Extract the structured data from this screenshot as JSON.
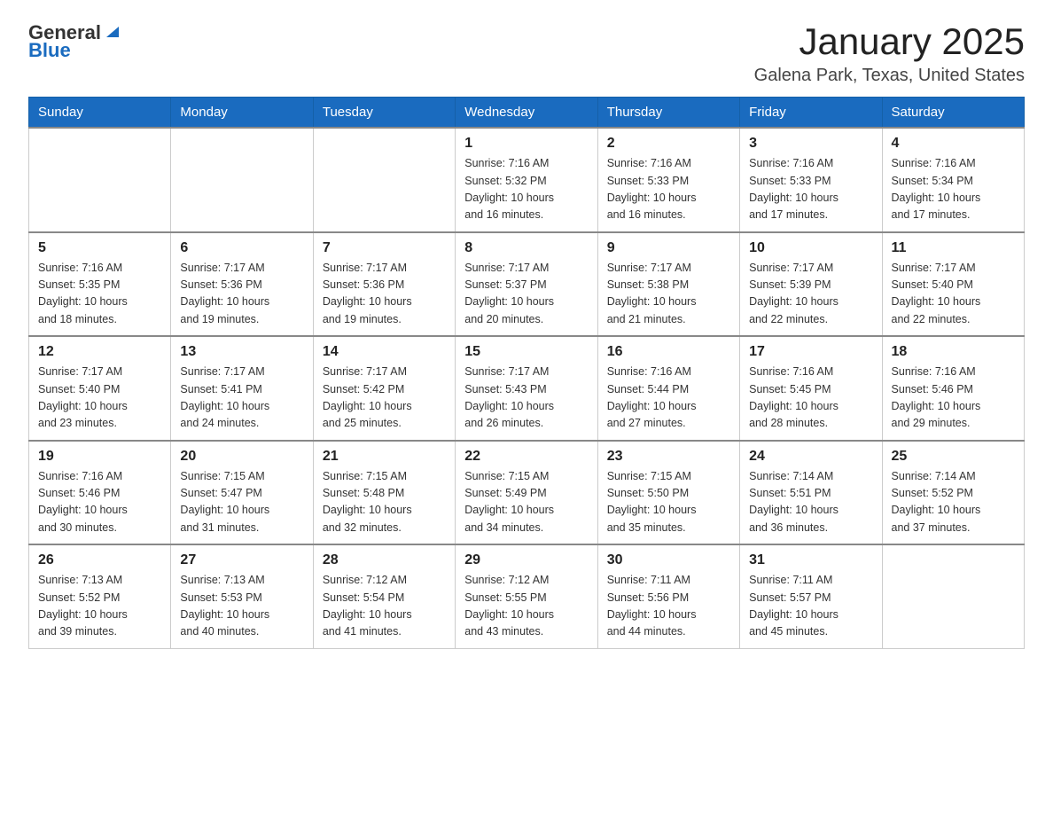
{
  "header": {
    "logo": {
      "general": "General",
      "blue": "Blue"
    },
    "month_title": "January 2025",
    "location": "Galena Park, Texas, United States"
  },
  "weekdays": [
    "Sunday",
    "Monday",
    "Tuesday",
    "Wednesday",
    "Thursday",
    "Friday",
    "Saturday"
  ],
  "weeks": [
    [
      {
        "day": "",
        "info": ""
      },
      {
        "day": "",
        "info": ""
      },
      {
        "day": "",
        "info": ""
      },
      {
        "day": "1",
        "info": "Sunrise: 7:16 AM\nSunset: 5:32 PM\nDaylight: 10 hours\nand 16 minutes."
      },
      {
        "day": "2",
        "info": "Sunrise: 7:16 AM\nSunset: 5:33 PM\nDaylight: 10 hours\nand 16 minutes."
      },
      {
        "day": "3",
        "info": "Sunrise: 7:16 AM\nSunset: 5:33 PM\nDaylight: 10 hours\nand 17 minutes."
      },
      {
        "day": "4",
        "info": "Sunrise: 7:16 AM\nSunset: 5:34 PM\nDaylight: 10 hours\nand 17 minutes."
      }
    ],
    [
      {
        "day": "5",
        "info": "Sunrise: 7:16 AM\nSunset: 5:35 PM\nDaylight: 10 hours\nand 18 minutes."
      },
      {
        "day": "6",
        "info": "Sunrise: 7:17 AM\nSunset: 5:36 PM\nDaylight: 10 hours\nand 19 minutes."
      },
      {
        "day": "7",
        "info": "Sunrise: 7:17 AM\nSunset: 5:36 PM\nDaylight: 10 hours\nand 19 minutes."
      },
      {
        "day": "8",
        "info": "Sunrise: 7:17 AM\nSunset: 5:37 PM\nDaylight: 10 hours\nand 20 minutes."
      },
      {
        "day": "9",
        "info": "Sunrise: 7:17 AM\nSunset: 5:38 PM\nDaylight: 10 hours\nand 21 minutes."
      },
      {
        "day": "10",
        "info": "Sunrise: 7:17 AM\nSunset: 5:39 PM\nDaylight: 10 hours\nand 22 minutes."
      },
      {
        "day": "11",
        "info": "Sunrise: 7:17 AM\nSunset: 5:40 PM\nDaylight: 10 hours\nand 22 minutes."
      }
    ],
    [
      {
        "day": "12",
        "info": "Sunrise: 7:17 AM\nSunset: 5:40 PM\nDaylight: 10 hours\nand 23 minutes."
      },
      {
        "day": "13",
        "info": "Sunrise: 7:17 AM\nSunset: 5:41 PM\nDaylight: 10 hours\nand 24 minutes."
      },
      {
        "day": "14",
        "info": "Sunrise: 7:17 AM\nSunset: 5:42 PM\nDaylight: 10 hours\nand 25 minutes."
      },
      {
        "day": "15",
        "info": "Sunrise: 7:17 AM\nSunset: 5:43 PM\nDaylight: 10 hours\nand 26 minutes."
      },
      {
        "day": "16",
        "info": "Sunrise: 7:16 AM\nSunset: 5:44 PM\nDaylight: 10 hours\nand 27 minutes."
      },
      {
        "day": "17",
        "info": "Sunrise: 7:16 AM\nSunset: 5:45 PM\nDaylight: 10 hours\nand 28 minutes."
      },
      {
        "day": "18",
        "info": "Sunrise: 7:16 AM\nSunset: 5:46 PM\nDaylight: 10 hours\nand 29 minutes."
      }
    ],
    [
      {
        "day": "19",
        "info": "Sunrise: 7:16 AM\nSunset: 5:46 PM\nDaylight: 10 hours\nand 30 minutes."
      },
      {
        "day": "20",
        "info": "Sunrise: 7:15 AM\nSunset: 5:47 PM\nDaylight: 10 hours\nand 31 minutes."
      },
      {
        "day": "21",
        "info": "Sunrise: 7:15 AM\nSunset: 5:48 PM\nDaylight: 10 hours\nand 32 minutes."
      },
      {
        "day": "22",
        "info": "Sunrise: 7:15 AM\nSunset: 5:49 PM\nDaylight: 10 hours\nand 34 minutes."
      },
      {
        "day": "23",
        "info": "Sunrise: 7:15 AM\nSunset: 5:50 PM\nDaylight: 10 hours\nand 35 minutes."
      },
      {
        "day": "24",
        "info": "Sunrise: 7:14 AM\nSunset: 5:51 PM\nDaylight: 10 hours\nand 36 minutes."
      },
      {
        "day": "25",
        "info": "Sunrise: 7:14 AM\nSunset: 5:52 PM\nDaylight: 10 hours\nand 37 minutes."
      }
    ],
    [
      {
        "day": "26",
        "info": "Sunrise: 7:13 AM\nSunset: 5:52 PM\nDaylight: 10 hours\nand 39 minutes."
      },
      {
        "day": "27",
        "info": "Sunrise: 7:13 AM\nSunset: 5:53 PM\nDaylight: 10 hours\nand 40 minutes."
      },
      {
        "day": "28",
        "info": "Sunrise: 7:12 AM\nSunset: 5:54 PM\nDaylight: 10 hours\nand 41 minutes."
      },
      {
        "day": "29",
        "info": "Sunrise: 7:12 AM\nSunset: 5:55 PM\nDaylight: 10 hours\nand 43 minutes."
      },
      {
        "day": "30",
        "info": "Sunrise: 7:11 AM\nSunset: 5:56 PM\nDaylight: 10 hours\nand 44 minutes."
      },
      {
        "day": "31",
        "info": "Sunrise: 7:11 AM\nSunset: 5:57 PM\nDaylight: 10 hours\nand 45 minutes."
      },
      {
        "day": "",
        "info": ""
      }
    ]
  ]
}
